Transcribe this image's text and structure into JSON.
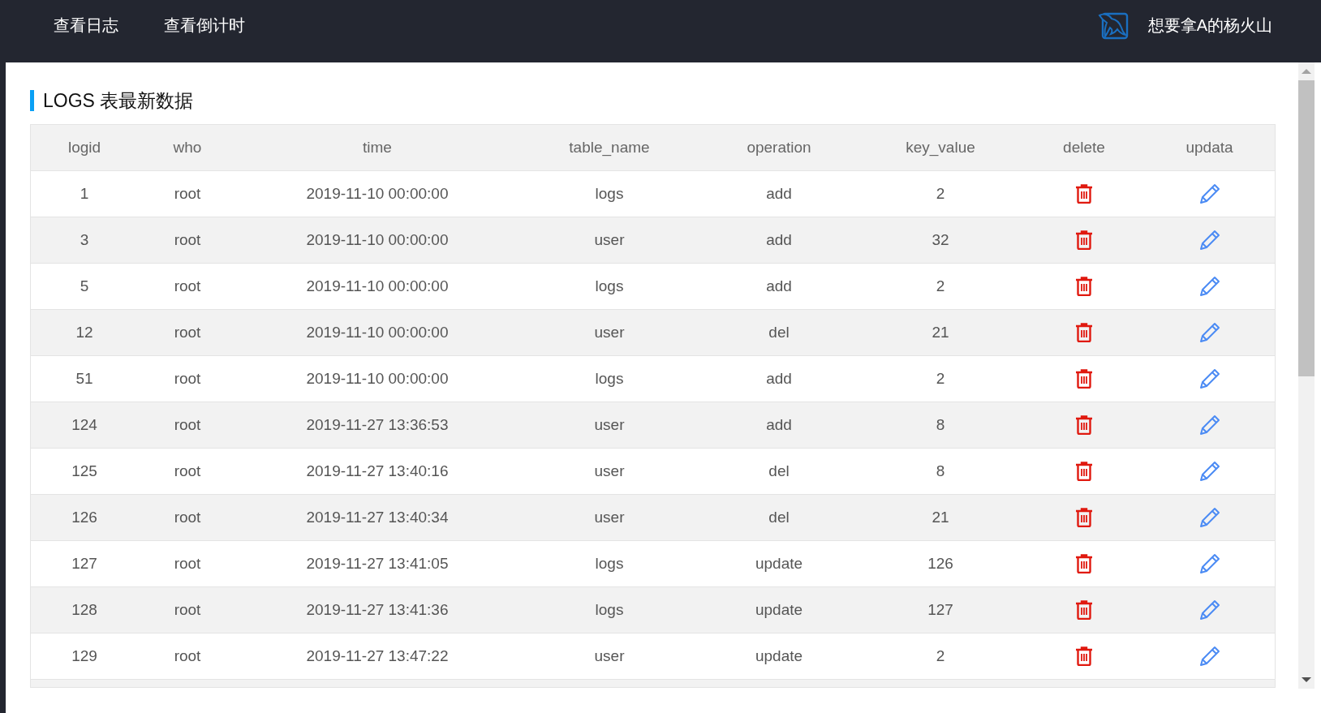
{
  "nav": {
    "items": [
      "查看日志",
      "查看倒计时"
    ],
    "user": "想要拿A的杨火山"
  },
  "section": {
    "title": "LOGS 表最新数据"
  },
  "table": {
    "columns": [
      "logid",
      "who",
      "time",
      "table_name",
      "operation",
      "key_value",
      "delete",
      "updata"
    ],
    "rows": [
      {
        "logid": "1",
        "who": "root",
        "time": "2019-11-10 00:00:00",
        "table_name": "logs",
        "operation": "add",
        "key_value": "2"
      },
      {
        "logid": "3",
        "who": "root",
        "time": "2019-11-10 00:00:00",
        "table_name": "user",
        "operation": "add",
        "key_value": "32"
      },
      {
        "logid": "5",
        "who": "root",
        "time": "2019-11-10 00:00:00",
        "table_name": "logs",
        "operation": "add",
        "key_value": "2"
      },
      {
        "logid": "12",
        "who": "root",
        "time": "2019-11-10 00:00:00",
        "table_name": "user",
        "operation": "del",
        "key_value": "21"
      },
      {
        "logid": "51",
        "who": "root",
        "time": "2019-11-10 00:00:00",
        "table_name": "logs",
        "operation": "add",
        "key_value": "2"
      },
      {
        "logid": "124",
        "who": "root",
        "time": "2019-11-27 13:36:53",
        "table_name": "user",
        "operation": "add",
        "key_value": "8"
      },
      {
        "logid": "125",
        "who": "root",
        "time": "2019-11-27 13:40:16",
        "table_name": "user",
        "operation": "del",
        "key_value": "8"
      },
      {
        "logid": "126",
        "who": "root",
        "time": "2019-11-27 13:40:34",
        "table_name": "user",
        "operation": "del",
        "key_value": "21"
      },
      {
        "logid": "127",
        "who": "root",
        "time": "2019-11-27 13:41:05",
        "table_name": "logs",
        "operation": "update",
        "key_value": "126"
      },
      {
        "logid": "128",
        "who": "root",
        "time": "2019-11-27 13:41:36",
        "table_name": "logs",
        "operation": "update",
        "key_value": "127"
      },
      {
        "logid": "129",
        "who": "root",
        "time": "2019-11-27 13:47:22",
        "table_name": "user",
        "operation": "update",
        "key_value": "2"
      }
    ]
  }
}
